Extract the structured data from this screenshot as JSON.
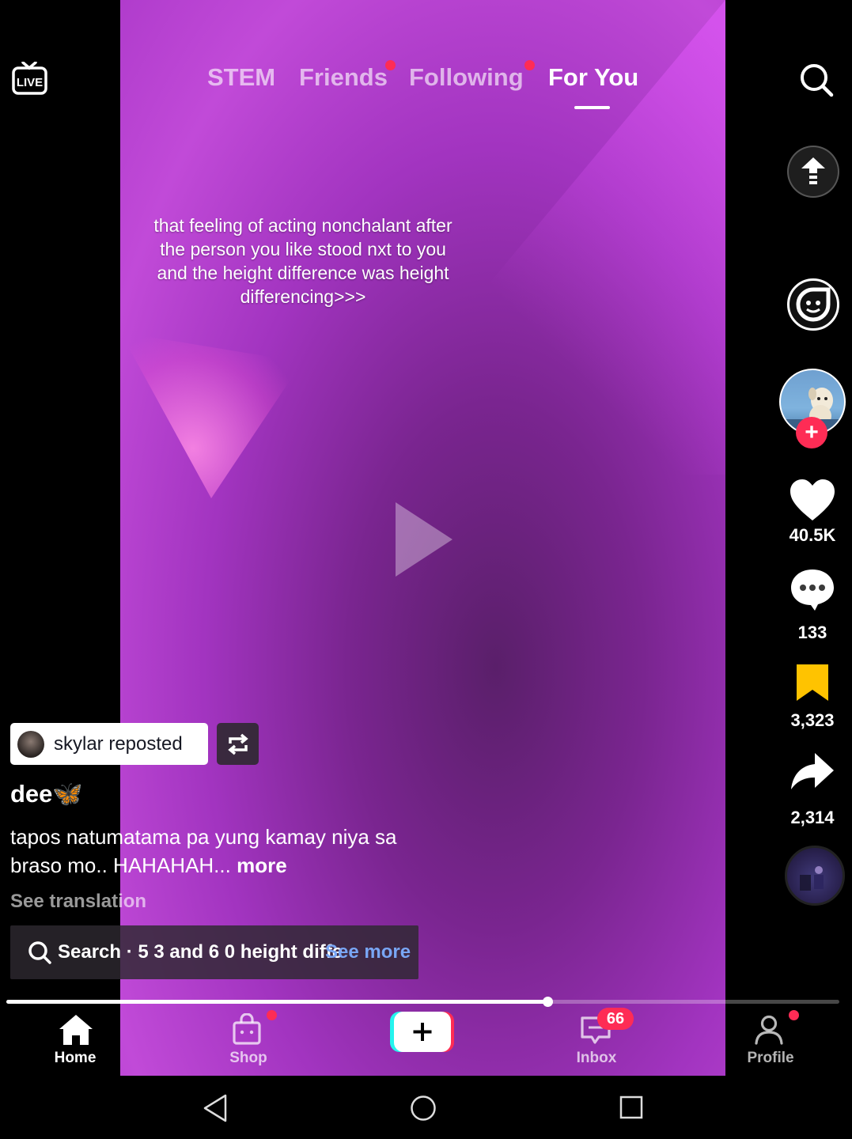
{
  "top_tabs": {
    "items": [
      {
        "label": "STEM",
        "dot": false
      },
      {
        "label": "Friends",
        "dot": true
      },
      {
        "label": "Following",
        "dot": true
      },
      {
        "label": "For You",
        "dot": false,
        "active": true
      }
    ]
  },
  "video": {
    "caption": "that feeling of acting nonchalant after the person you like stood nxt to you and the height difference was height differencing>>>"
  },
  "actions": {
    "likes": "40.5K",
    "comments": "133",
    "saves": "3,323",
    "shares": "2,314"
  },
  "post": {
    "repost_label": "skylar reposted",
    "username": "dee🦋",
    "description": "tapos natumatama pa yung kamay niya sa braso mo.. HAHAHAH...",
    "more_label": "more",
    "see_translation": "See translation",
    "search_text": "Search · 5 3 and 6 0 height diffe",
    "search_see_more": "See more"
  },
  "playback": {
    "progress": 0.65
  },
  "nav": {
    "home": "Home",
    "shop": "Shop",
    "inbox": "Inbox",
    "inbox_badge": "66",
    "profile": "Profile"
  },
  "colors": {
    "accent": "#fe2c55",
    "saved": "#ffc300",
    "link": "#79a6f5"
  }
}
